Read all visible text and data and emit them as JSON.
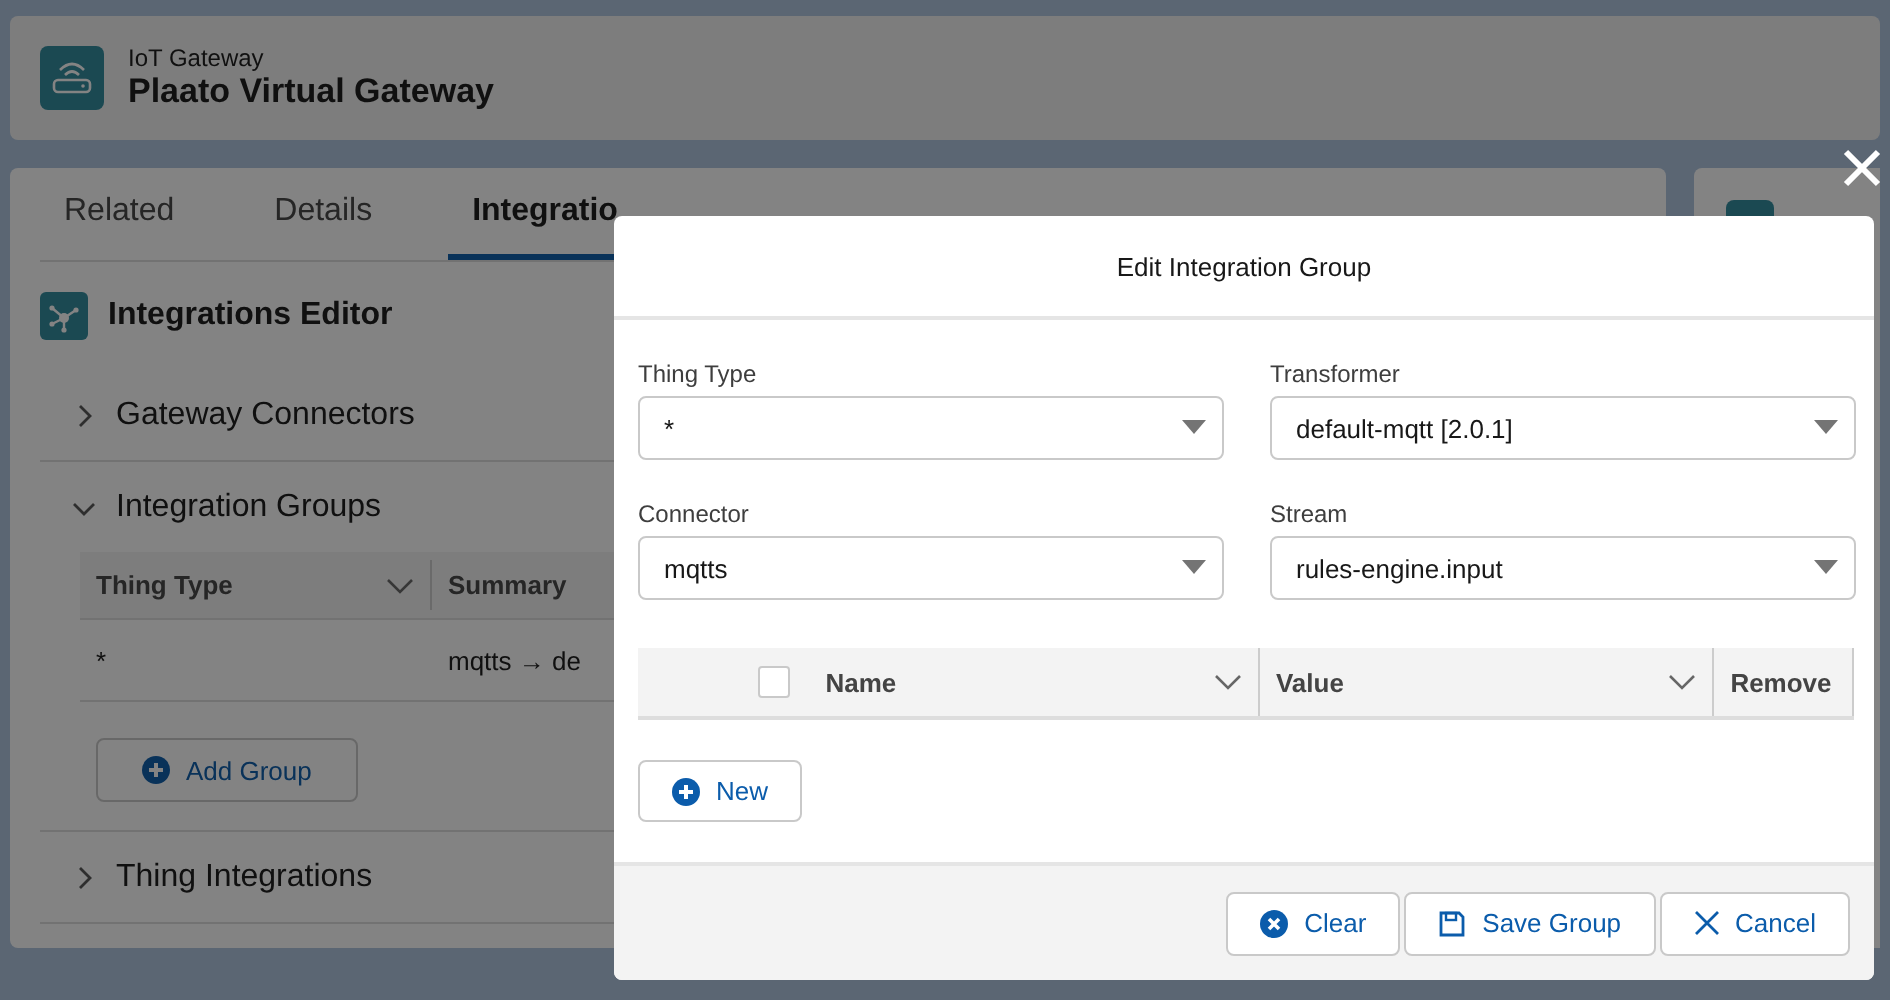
{
  "header": {
    "object_type": "IoT Gateway",
    "title": "Plaato Virtual Gateway"
  },
  "tabs": [
    {
      "label": "Related",
      "selected": false
    },
    {
      "label": "Details",
      "selected": false
    },
    {
      "label": "Integratio",
      "selected": true
    }
  ],
  "editor": {
    "title": "Integrations Editor",
    "sections": [
      {
        "label": "Gateway Connectors",
        "expanded": false
      },
      {
        "label": "Integration Groups",
        "expanded": true,
        "table": {
          "columns": [
            {
              "label": "Thing Type",
              "menu": true
            },
            {
              "label": "Summary",
              "menu": false
            }
          ],
          "rows": [
            [
              "*",
              "mqtts → de"
            ]
          ]
        },
        "button": "Add Group"
      },
      {
        "label": "Thing Integrations",
        "expanded": false
      }
    ]
  },
  "modal": {
    "title": "Edit Integration Group",
    "fields": [
      {
        "label": "Thing Type",
        "value": "*"
      },
      {
        "label": "Transformer",
        "value": "default-mqtt [2.0.1]"
      },
      {
        "label": "Connector",
        "value": "mqtts"
      },
      {
        "label": "Stream",
        "value": "rules-engine.input"
      }
    ],
    "table": {
      "select_all_checked": false,
      "columns": [
        {
          "label": "Name",
          "menu": true
        },
        {
          "label": "Value",
          "menu": true
        },
        {
          "label": "Remove",
          "menu": false
        }
      ]
    },
    "new_button": "New",
    "footer_buttons": [
      {
        "label": "Clear",
        "kind": "clear"
      },
      {
        "label": "Save Group",
        "kind": "save"
      },
      {
        "label": "Cancel",
        "kind": "cancel"
      }
    ]
  }
}
